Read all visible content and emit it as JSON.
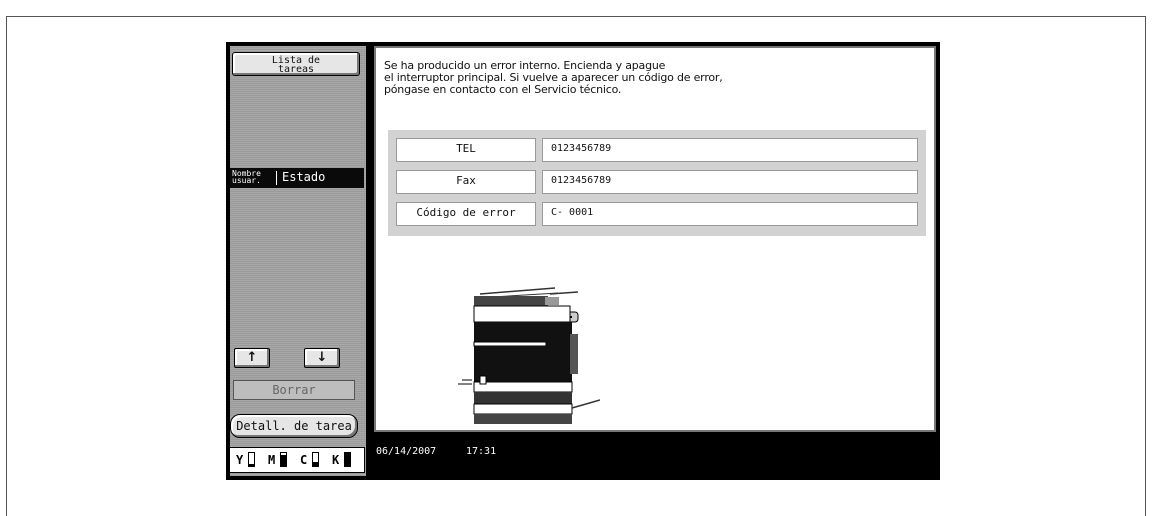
{
  "left_panel": {
    "task_list_button": [
      "Lista de",
      "tareas"
    ],
    "name_header": [
      "Nombre",
      "usuar."
    ],
    "status_header": "Estado",
    "up_arrow": "↑",
    "down_arrow": "↓",
    "delete_button": "Borrar",
    "job_details_button": "Detall. de tarea",
    "toner": [
      {
        "label": "Y",
        "level": 0.15
      },
      {
        "label": "M",
        "level": 0.85
      },
      {
        "label": "C",
        "level": 0.3
      },
      {
        "label": "K",
        "level": 1.0
      }
    ]
  },
  "main": {
    "message": [
      "Se ha producido un error  interno. Encienda y apague",
      "el interruptor principal. Si vuelve a aparecer un código de error,",
      "póngase en contacto con  el Servicio técnico."
    ],
    "rows": [
      {
        "key": "TEL",
        "value": "0123456789"
      },
      {
        "key": "Fax",
        "value": "0123456789"
      },
      {
        "key": "Código de error",
        "value": "C- 0001"
      }
    ]
  },
  "status_bar": {
    "date": "06/14/2007",
    "time": "17:31"
  }
}
